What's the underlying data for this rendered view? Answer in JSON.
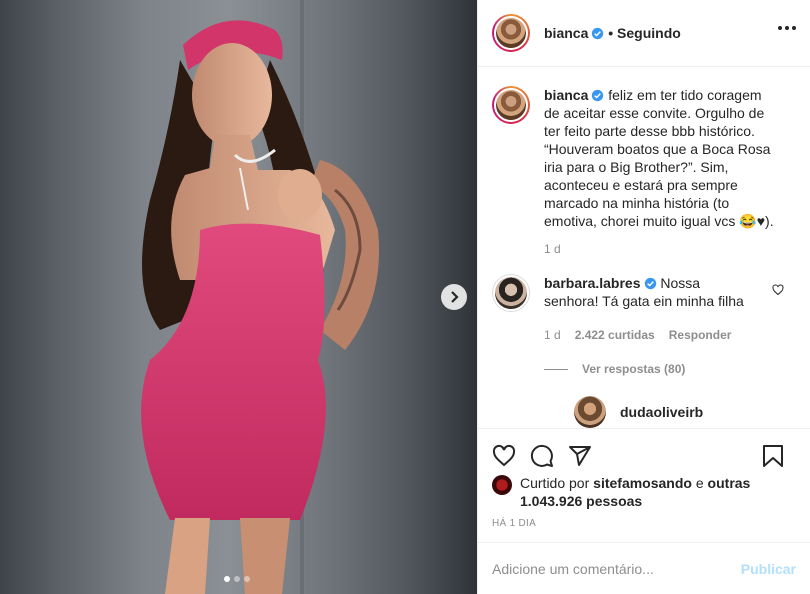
{
  "post": {
    "author": "bianca",
    "follow_status": "• Seguindo",
    "caption": "feliz em ter tido coragem de aceitar esse convite. Orgulho de ter feito parte desse bbb histórico. “Houveram boatos que a Boca Rosa iria para o Big Brother?”. Sim, aconteceu e estará pra sempre marcado na minha história (to emotiva, chorei muito igual vcs 😂♥).",
    "caption_time": "1 d",
    "carousel_count": 3,
    "carousel_active": 0
  },
  "comments": [
    {
      "user": "barbara.labres",
      "text": "Nossa senhora! Tá gata ein minha filha",
      "time": "1 d",
      "likes": "2.422 curtidas",
      "reply_label": "Responder",
      "view_replies": "Ver respostas (80)"
    }
  ],
  "sub_comment": {
    "user": "dudaoliveirb"
  },
  "likes": {
    "prefix": "Curtido por",
    "user": "sitefamosando",
    "connector": "e",
    "others": "outras 1.043.926 pessoas"
  },
  "posted_ago": "HÁ 1 DIA",
  "add_comment": {
    "placeholder": "Adicione um comentário...",
    "publish": "Publicar"
  },
  "colors": {
    "dress": "#d8386e",
    "verified": "#3897f0",
    "publish_disabled": "#b2dffc"
  },
  "icons": [
    "heart-icon",
    "comment-icon",
    "share-icon",
    "save-icon",
    "more-icon",
    "chevron-right-icon",
    "verified-icon"
  ]
}
